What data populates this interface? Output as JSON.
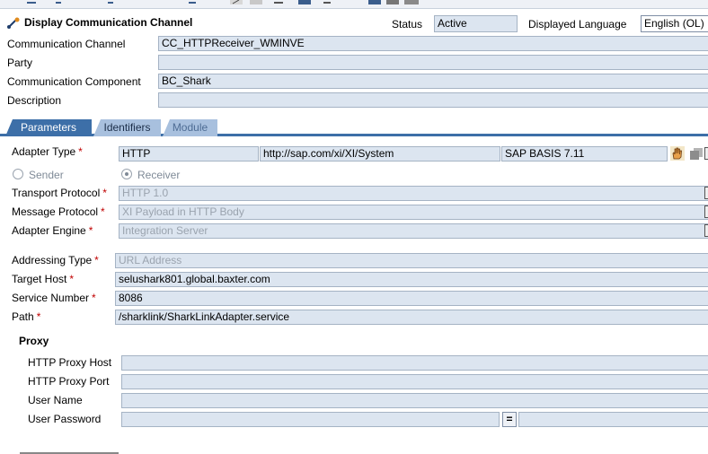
{
  "header": {
    "title": "Display Communication Channel",
    "status_label": "Status",
    "status_value": "Active",
    "language_label": "Displayed Language",
    "language_value": "English (OL)"
  },
  "general": {
    "channel_label": "Communication Channel",
    "channel_value": "CC_HTTPReceiver_WMINVE",
    "party_label": "Party",
    "party_value": "",
    "component_label": "Communication Component",
    "component_value": "BC_Shark",
    "description_label": "Description",
    "description_value": ""
  },
  "tabs": [
    {
      "label": "Parameters"
    },
    {
      "label": "Identifiers"
    },
    {
      "label": "Module"
    }
  ],
  "params": {
    "adapter_type_label": "Adapter Type",
    "adapter_type_value": "HTTP",
    "adapter_namespace": "http://sap.com/xi/XI/System",
    "adapter_swcv": "SAP BASIS 7.11",
    "sender_label": "Sender",
    "receiver_label": "Receiver",
    "transport_label": "Transport Protocol",
    "transport_value": "HTTP 1.0",
    "message_label": "Message Protocol",
    "message_value": "XI Payload in HTTP Body",
    "engine_label": "Adapter Engine",
    "engine_value": "Integration Server",
    "addressing_label": "Addressing Type",
    "addressing_value": "URL Address",
    "host_label": "Target Host",
    "host_value": "selushark801.global.baxter.com",
    "service_label": "Service Number",
    "service_value": "8086",
    "path_label": "Path",
    "path_value": "/sharklink/SharkLinkAdapter.service",
    "required_mark": "*"
  },
  "proxy": {
    "title": "Proxy",
    "host_label": "HTTP Proxy Host",
    "port_label": "HTTP Proxy Port",
    "user_label": "User Name",
    "password_label": "User Password",
    "equals_symbol": "="
  },
  "colors": {
    "tab_active": "#3d6fa8",
    "tab_inactive": "#a8c0de",
    "field_bg": "#dce5f0",
    "required": "#c00000"
  }
}
